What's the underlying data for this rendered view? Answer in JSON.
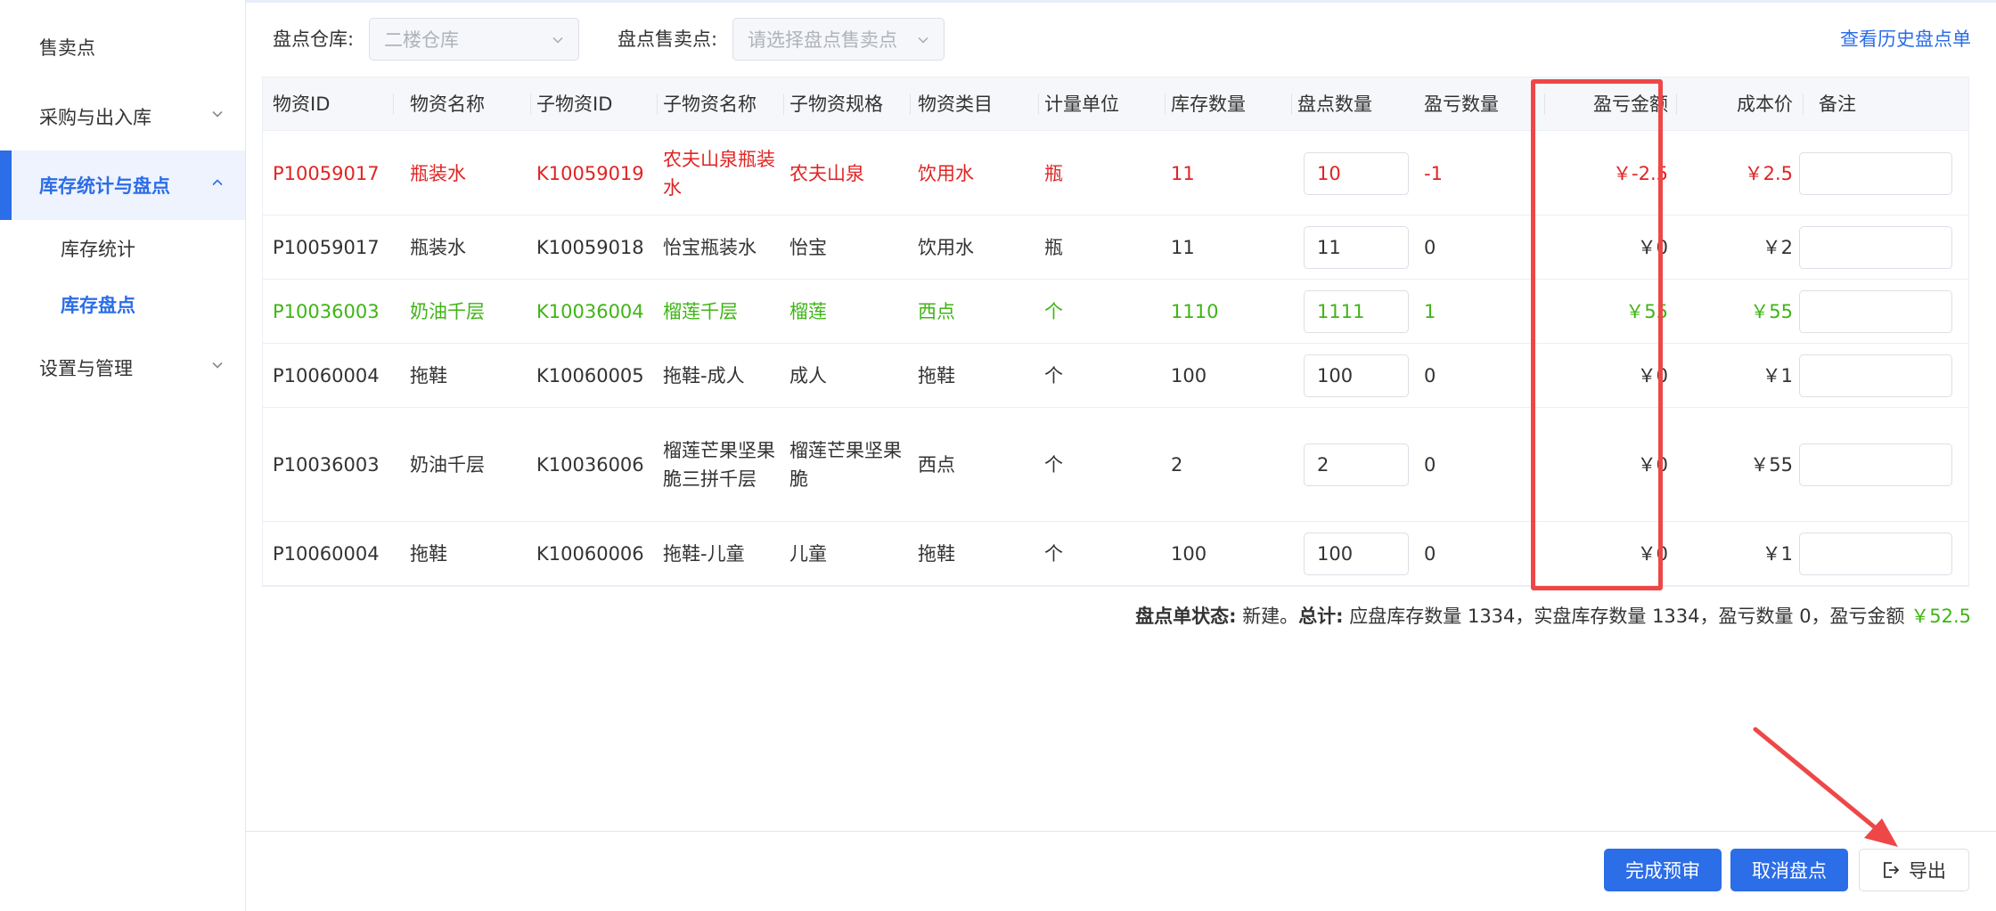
{
  "sidebar": {
    "items": [
      {
        "label": "售卖点"
      },
      {
        "label": "采购与出入库"
      },
      {
        "label": "库存统计与盘点"
      },
      {
        "label": "设置与管理"
      }
    ],
    "sub_items": [
      {
        "label": "库存统计"
      },
      {
        "label": "库存盘点"
      }
    ]
  },
  "filters": {
    "warehouse_label": "盘点仓库:",
    "warehouse_value": "二楼仓库",
    "sale_point_label": "盘点售卖点:",
    "sale_point_placeholder": "请选择盘点售卖点",
    "history_link": "查看历史盘点单"
  },
  "table": {
    "headers": [
      "物资ID",
      "物资名称",
      "子物资ID",
      "子物资名称",
      "子物资规格",
      "物资类目",
      "计量单位",
      "库存数量",
      "盘点数量",
      "盈亏数量",
      "盈亏金额",
      "成本价",
      "备注"
    ],
    "rows": [
      {
        "style": "red",
        "id": "P10059017",
        "name": "瓶装水",
        "sub_id": "K10059019",
        "sub_name": "农夫山泉瓶装水",
        "spec": "农夫山泉",
        "category": "饮用水",
        "unit": "瓶",
        "stock": "11",
        "count": "10",
        "diff": "-1",
        "amount": "￥-2.5",
        "cost": "￥2.5"
      },
      {
        "style": "normal",
        "id": "P10059017",
        "name": "瓶装水",
        "sub_id": "K10059018",
        "sub_name": "怡宝瓶装水",
        "spec": "怡宝",
        "category": "饮用水",
        "unit": "瓶",
        "stock": "11",
        "count": "11",
        "diff": "0",
        "amount": "￥0",
        "cost": "￥2"
      },
      {
        "style": "green",
        "id": "P10036003",
        "name": "奶油千层",
        "sub_id": "K10036004",
        "sub_name": "榴莲千层",
        "spec": "榴莲",
        "category": "西点",
        "unit": "个",
        "stock": "1110",
        "count": "1111",
        "diff": "1",
        "amount": "￥55",
        "cost": "￥55"
      },
      {
        "style": "normal",
        "id": "P10060004",
        "name": "拖鞋",
        "sub_id": "K10060005",
        "sub_name": "拖鞋-成人",
        "spec": "成人",
        "category": "拖鞋",
        "unit": "个",
        "stock": "100",
        "count": "100",
        "diff": "0",
        "amount": "￥0",
        "cost": "￥1"
      },
      {
        "style": "normal",
        "id": "P10036003",
        "name": "奶油千层",
        "sub_id": "K10036006",
        "sub_name": "榴莲芒果坚果脆三拼千层",
        "spec": "榴莲芒果坚果脆",
        "category": "西点",
        "unit": "个",
        "stock": "2",
        "count": "2",
        "diff": "0",
        "amount": "￥0",
        "cost": "￥55"
      },
      {
        "style": "normal",
        "id": "P10060004",
        "name": "拖鞋",
        "sub_id": "K10060006",
        "sub_name": "拖鞋-儿童",
        "spec": "儿童",
        "category": "拖鞋",
        "unit": "个",
        "stock": "100",
        "count": "100",
        "diff": "0",
        "amount": "￥0",
        "cost": "￥1"
      }
    ]
  },
  "summary": {
    "status_label": "盘点单状态:",
    "status_value": "新建。",
    "total_label": "总计:",
    "total_text": "应盘库存数量 1334，实盘库存数量 1334，盈亏数量 0，盈亏金额 ",
    "total_amount": "￥52.5"
  },
  "buttons": {
    "complete": "完成预审",
    "cancel": "取消盘点",
    "export": "导出"
  },
  "colors": {
    "accent": "#2c6de8",
    "loss": "#e02424",
    "gain": "#3fb516",
    "highlight": "#ee4747"
  }
}
